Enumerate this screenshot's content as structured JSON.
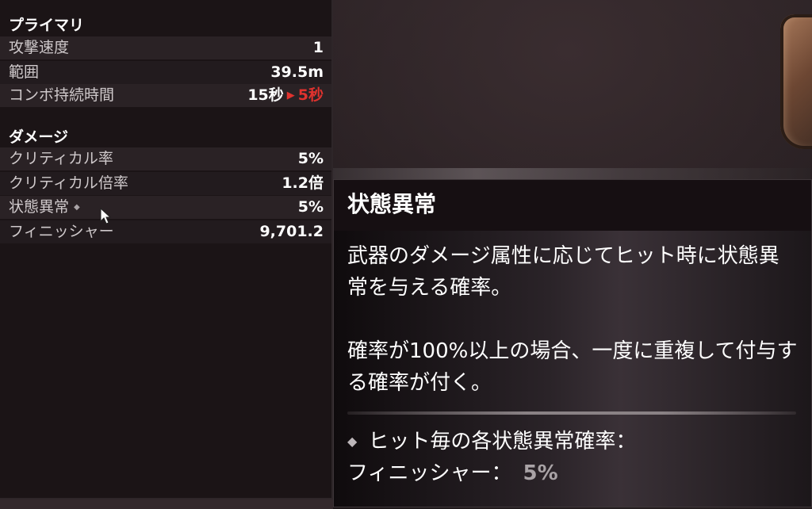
{
  "stats": {
    "primary_title": "プライマリ",
    "primary_rows": [
      {
        "label": "攻撃速度",
        "value": "1"
      },
      {
        "label": "範囲",
        "value": "39.5m"
      },
      {
        "label": "コンボ持続時間",
        "value_from": "15秒",
        "value_to": "5秒"
      }
    ],
    "damage_title": "ダメージ",
    "damage_rows": [
      {
        "label": "クリティカル率",
        "value": "5%"
      },
      {
        "label": "クリティカル倍率",
        "value": "1.2倍"
      },
      {
        "label": "状態異常",
        "value": "5%"
      },
      {
        "label": "フィニッシャー",
        "value": "9,701.2"
      }
    ]
  },
  "tooltip": {
    "title": "状態異常",
    "description_1": "武器のダメージ属性に応じてヒット時に状態異常を与える確率。",
    "description_2": "確率が100%以上の場合、一度に重複して付与する確率が付く。",
    "detail_label": "ヒット毎の各状態異常確率：",
    "detail_sub_label": "フィニッシャー：",
    "detail_value": "5%"
  },
  "icons": {
    "diamond": "diamond-icon",
    "arrow": "arrow-right-icon",
    "cursor": "mouse-cursor-icon"
  },
  "colors": {
    "decrease_red": "#e0322e",
    "panel_bg": "#1b1416"
  }
}
